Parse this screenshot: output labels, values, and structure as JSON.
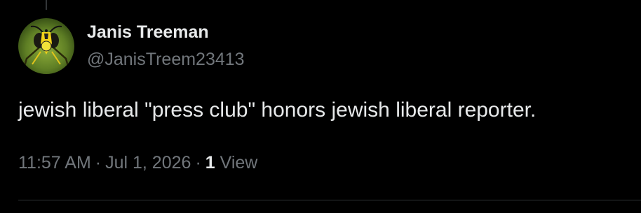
{
  "tweet": {
    "author": {
      "display_name": "Janis Treeman",
      "handle": "@JanisTreem23413",
      "avatar_icon": "wasp-avatar"
    },
    "text": "jewish liberal \"press club\" honors jewish liberal reporter.",
    "meta": {
      "time": "11:57 AM",
      "separator": "·",
      "date": "Jul 1, 2026",
      "views_count": "1",
      "views_label": "View"
    }
  },
  "colors": {
    "background": "#000000",
    "primary_text": "#e7e9ea",
    "secondary_text": "#71767b",
    "divider": "#2f3336"
  }
}
